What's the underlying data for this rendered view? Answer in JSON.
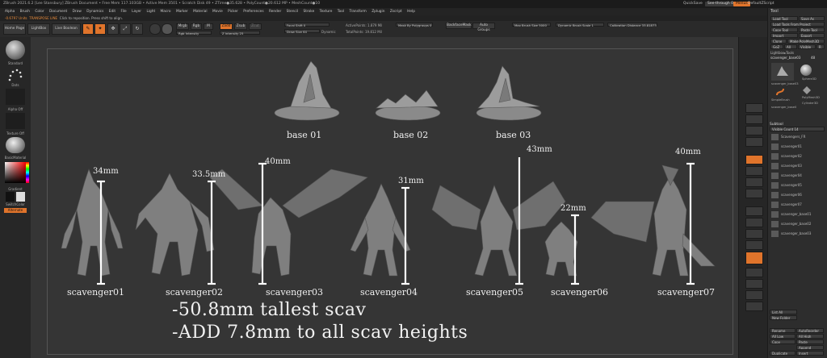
{
  "titlebar": {
    "title": "ZBrush 2021.6.2 [Lee Stansbury]   ZBrush Document   • Free Mem 117.103GB • Active Mem 3501 • Scratch Disk 49 • ZTime●35.628 • PolyCount●20.612 MP • MeshCount●10",
    "quicksave": "QuickSave",
    "see_through": "See-through  0",
    "menus": "Menus",
    "default_zscript": "DefaultZScript"
  },
  "menubar": [
    "Alpha",
    "Brush",
    "Color",
    "Document",
    "Draw",
    "Dynamics",
    "Edit",
    "File",
    "Layer",
    "Light",
    "Macro",
    "Marker",
    "Material",
    "Movie",
    "Picker",
    "Preferences",
    "Render",
    "Stencil",
    "Stroke",
    "Texture",
    "Tool",
    "Transform",
    "Zplugin",
    "Zscript",
    "Help"
  ],
  "infobar": {
    "prefix": "-0.6797 Units",
    "hint": "TRANSPOSE LINE",
    "text": "Click to reposition. Press shift to align."
  },
  "toolbar": {
    "home": "Home Page",
    "lightbox": "LightBox",
    "live_boolean": "Live Boolean",
    "edit": "Edit",
    "draw": "Draw",
    "move": "Move",
    "scale": "Scale",
    "rotate": "Rotate",
    "mrgb": "Mrgb",
    "rgb": "Rgb",
    "m": "M",
    "zadd": "Zadd",
    "zsub": "Zsub",
    "zcut": "Zcut",
    "rgb_intensity": "Rgb Intensity",
    "z_intensity": "Z Intensity  25",
    "focal_shift": "Focal Shift 0",
    "draw_size": "Draw Size  64",
    "dynamic": "Dynamic",
    "active_points": "ActivePoints: 1.879 Mil",
    "total_points": "TotalPoints: 19.812 Mil",
    "mask_by_polygroups": "Mask By Polygroups 0",
    "backface_mask": "BackfaceMask",
    "auto_groups": "Auto Groups",
    "max_brush_size": "Max Brush Size 5000",
    "dynamic_brush_scale": "Dynamic Brush Scale 1",
    "calibration_distance": "Calibration Distance  33.81873"
  },
  "leftshelf": {
    "standard": "Standard",
    "dots": "Dots",
    "alpha_off": "Alpha Off",
    "texture_off": "Texture Off",
    "matcap": "BasicMaterial",
    "gradient": "Gradient",
    "switch_color": "SwitchColor",
    "alternate": "Alternate"
  },
  "canvas": {
    "bases": [
      {
        "label": "base 01"
      },
      {
        "label": "base 02"
      },
      {
        "label": "base 03"
      }
    ],
    "figures": [
      {
        "label": "scavenger01",
        "height": "34mm"
      },
      {
        "label": "scavenger02",
        "height": "33.5mm"
      },
      {
        "label": "scavenger03",
        "height": "40mm"
      },
      {
        "label": "scavenger04",
        "height": "31mm"
      },
      {
        "label": "scavenger05",
        "height": "43mm"
      },
      {
        "label": "scavenger06",
        "height": "22mm"
      },
      {
        "label": "scavenger07",
        "height": "40mm"
      }
    ],
    "note_line1": "-50.8mm tallest scav",
    "note_line2": "-ADD 7.8mm to all scav heights"
  },
  "toolpanel": {
    "header": "Tool",
    "load_tool": "Load Tool",
    "save_as": "Save As",
    "load_tools_from_project": "Load Tools From Project",
    "copy_tool": "Copy Tool",
    "paste_tool": "Paste Tool",
    "import": "Import",
    "export": "Export",
    "clone": "Clone",
    "make_polymesh": "Make PolyMesh3D",
    "goz": "GoZ",
    "all": "All",
    "visible": "Visible",
    "r": "R",
    "lightbox_tools": "Lightbox▸Tools",
    "current_tool": "scavenger_base03",
    "current_value": "48",
    "thumb_labels": [
      "scavenger_base03",
      "Sphere3D",
      "SimpleBrush",
      "PolyMesh3D",
      "Cylinder3D",
      "scavenger_base0"
    ],
    "subtool_header": "Subtool",
    "visible_count": "Visible Count 14",
    "subtools": [
      "Scavengers_FR",
      "scavenger01",
      "scavenger02",
      "scavenger03",
      "scavenger04",
      "scavenger05",
      "scavenger06",
      "scavenger07",
      "scavenger_base01",
      "scavenger_base02",
      "scavenger_base03"
    ],
    "list_all": "List All",
    "new_folder": "New Folder",
    "rename": "Rename",
    "autoreorder": "AutoReorder",
    "all_low": "All Low",
    "all_high": "All High",
    "copy": "Copy",
    "paste": "Paste",
    "append": "Append",
    "duplicate": "Duplicate",
    "insert": "Insert"
  },
  "colors": {
    "accent": "#e0742b",
    "canvas": "#353535",
    "panel": "#2d2d2d"
  }
}
